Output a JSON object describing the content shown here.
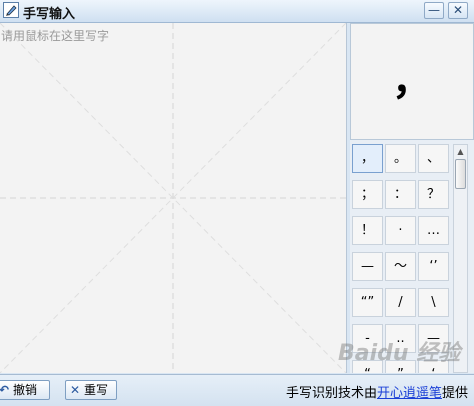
{
  "window": {
    "title": "手写输入",
    "minimize_glyph": "—",
    "close_glyph": "✕"
  },
  "canvas": {
    "hint": "请用鼠标在这里写字"
  },
  "preview": {
    "char": "，"
  },
  "candidates": [
    "，",
    "。",
    "、",
    "；",
    "：",
    "？",
    "！",
    "·",
    "…",
    "—",
    "～",
    "‘’",
    "“”",
    "/",
    "\\",
    "-",
    "..",
    "—",
    "“",
    "”",
    "‘"
  ],
  "bottom": {
    "undo_label": "撤销",
    "rewrite_label": "重写",
    "credit_prefix": "手写识别技术由",
    "credit_link": "开心逍遥笔",
    "credit_suffix": "提供"
  },
  "watermark": "Baidu 经验",
  "icons": {
    "undo": "undo-arrow-icon",
    "rewrite": "x-icon",
    "title": "pencil-icon"
  },
  "colors": {
    "link": "#1a3fd6",
    "titlebar": "#cfe0f1"
  }
}
